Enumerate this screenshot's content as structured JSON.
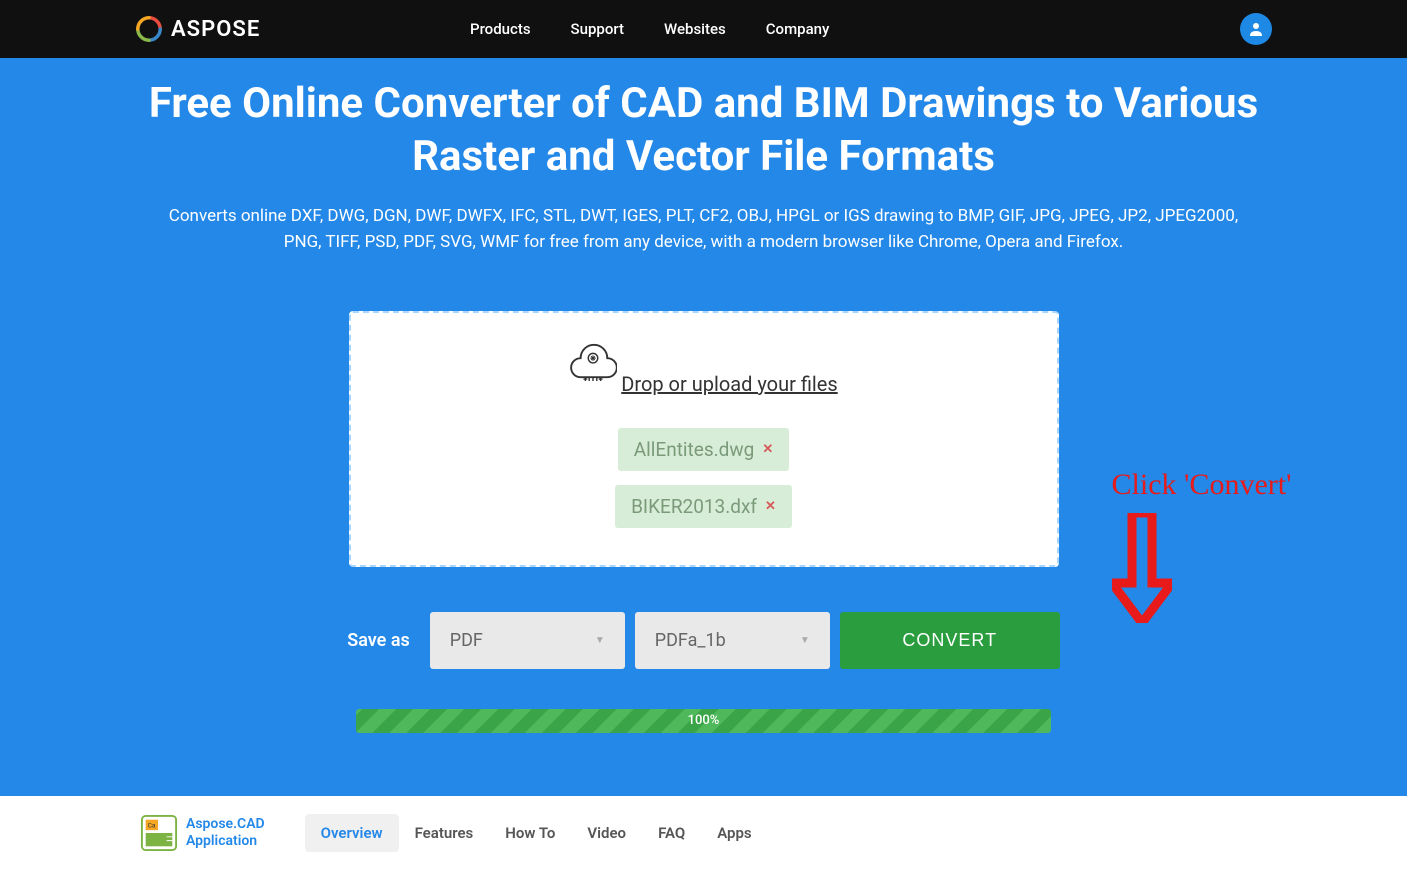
{
  "header": {
    "brand": "ASPOSE",
    "nav": [
      "Products",
      "Support",
      "Websites",
      "Company"
    ]
  },
  "hero": {
    "title": "Free Online Converter of CAD and BIM Drawings to Various Raster and Vector File Formats",
    "description": "Converts online DXF, DWG, DGN, DWF, DWFX, IFC, STL, DWT, IGES, PLT, CF2, OBJ, HPGL or IGS drawing to BMP, GIF, JPG, JPEG, JP2, JPEG2000, PNG, TIFF, PSD, PDF, SVG, WMF for free from any device, with a modern browser like Chrome, Opera and Firefox."
  },
  "upload": {
    "label": "Drop or upload your files",
    "files": [
      "AllEntites.dwg",
      "BIKER2013.dxf"
    ]
  },
  "annotation": {
    "text": "Click 'Convert'"
  },
  "controls": {
    "saveAs": "Save as",
    "format": "PDF",
    "subformat": "PDFa_1b",
    "convertBtn": "CONVERT"
  },
  "progress": {
    "text": "100%"
  },
  "footer": {
    "appName1": "Aspose.CAD",
    "appName2": "Application",
    "tabs": [
      "Overview",
      "Features",
      "How To",
      "Video",
      "FAQ",
      "Apps"
    ],
    "activeTab": 0
  }
}
